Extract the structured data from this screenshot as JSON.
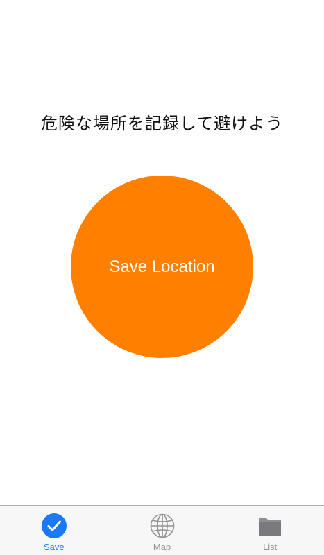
{
  "headline": "危険な場所を記録して避けよう",
  "save_button": {
    "label": "Save Location",
    "color": "#ff8000"
  },
  "tabbar": {
    "active_color": "#1a7af5",
    "inactive_color": "#929292",
    "tabs": [
      {
        "label": "Save",
        "icon": "checkmark-circle-icon",
        "active": true
      },
      {
        "label": "Map",
        "icon": "globe-icon",
        "active": false
      },
      {
        "label": "List",
        "icon": "folder-icon",
        "active": false
      }
    ]
  }
}
